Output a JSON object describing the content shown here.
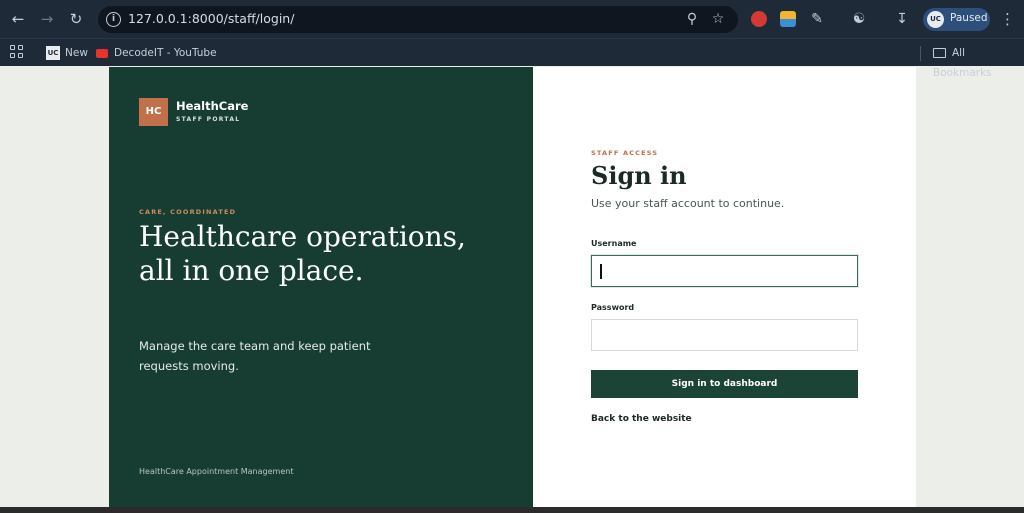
{
  "browser": {
    "url": "127.0.0.1:8000/staff/login/",
    "profile_initials": "UC",
    "profile_status": "Paused",
    "bookmarks": [
      {
        "label": "New",
        "icon": "site-favicon"
      },
      {
        "label": "DecodeIT - YouTube",
        "icon": "youtube-icon"
      }
    ],
    "all_bookmarks_label": "All Bookmarks"
  },
  "brand": {
    "logo_text": "HC",
    "name": "HealthCare",
    "tagline": "STAFF PORTAL"
  },
  "hero": {
    "eyebrow": "CARE, COORDINATED",
    "headline": "Healthcare operations, all in one place.",
    "lead": "Manage the care team and keep patient requests moving.",
    "footer": "HealthCare Appointment Management"
  },
  "login": {
    "eyebrow": "STAFF ACCESS",
    "title": "Sign in",
    "subtitle": "Use your staff account to continue.",
    "username_label": "Username",
    "username_value": "",
    "password_label": "Password",
    "password_value": "",
    "submit_label": "Sign in to dashboard",
    "back_link": "Back to the website"
  },
  "colors": {
    "panel_dark": "#173d32",
    "accent": "#c0704a",
    "button": "#1b4436",
    "page_bg": "#eceeea"
  }
}
